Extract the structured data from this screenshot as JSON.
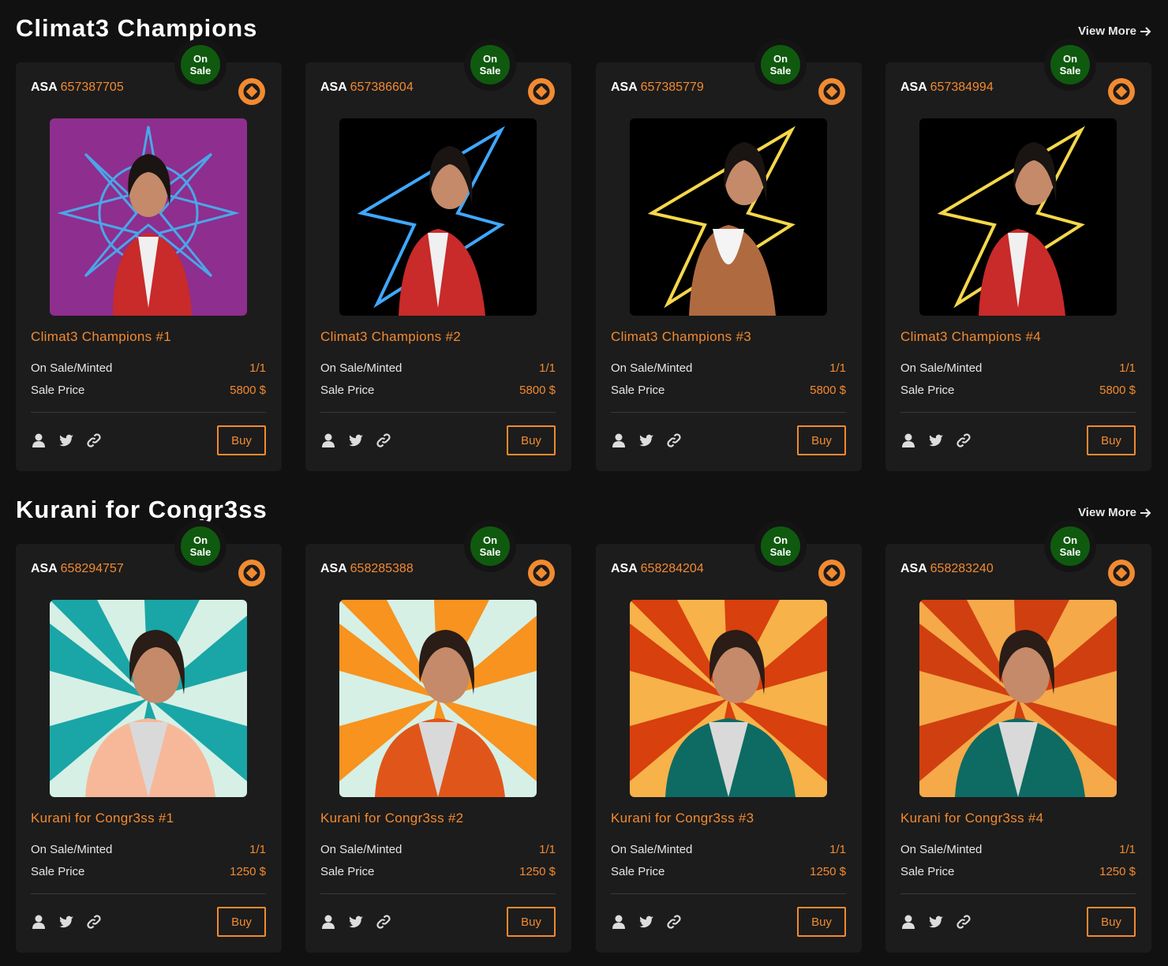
{
  "sections": [
    {
      "title": "Climat3 Champions",
      "view_more": "View More",
      "cards": [
        {
          "badge_line1": "On",
          "badge_line2": "Sale",
          "asa_label": "ASA",
          "asa_id": "657387705",
          "name": "Climat3 Champions #1",
          "on_sale_label": "On Sale/Minted",
          "on_sale_value": "1/1",
          "price_label": "Sale Price",
          "price_value": "5800 $",
          "buy_label": "Buy"
        },
        {
          "badge_line1": "On",
          "badge_line2": "Sale",
          "asa_label": "ASA",
          "asa_id": "657386604",
          "name": "Climat3 Champions #2",
          "on_sale_label": "On Sale/Minted",
          "on_sale_value": "1/1",
          "price_label": "Sale Price",
          "price_value": "5800 $",
          "buy_label": "Buy"
        },
        {
          "badge_line1": "On",
          "badge_line2": "Sale",
          "asa_label": "ASA",
          "asa_id": "657385779",
          "name": "Climat3 Champions #3",
          "on_sale_label": "On Sale/Minted",
          "on_sale_value": "1/1",
          "price_label": "Sale Price",
          "price_value": "5800 $",
          "buy_label": "Buy"
        },
        {
          "badge_line1": "On",
          "badge_line2": "Sale",
          "asa_label": "ASA",
          "asa_id": "657384994",
          "name": "Climat3 Champions #4",
          "on_sale_label": "On Sale/Minted",
          "on_sale_value": "1/1",
          "price_label": "Sale Price",
          "price_value": "5800 $",
          "buy_label": "Buy"
        }
      ]
    },
    {
      "title": "Kurani for Congr3ss",
      "view_more": "View More",
      "cards": [
        {
          "badge_line1": "On",
          "badge_line2": "Sale",
          "asa_label": "ASA",
          "asa_id": "658294757",
          "name": "Kurani for Congr3ss #1",
          "on_sale_label": "On Sale/Minted",
          "on_sale_value": "1/1",
          "price_label": "Sale Price",
          "price_value": "1250 $",
          "buy_label": "Buy"
        },
        {
          "badge_line1": "On",
          "badge_line2": "Sale",
          "asa_label": "ASA",
          "asa_id": "658285388",
          "name": "Kurani for Congr3ss #2",
          "on_sale_label": "On Sale/Minted",
          "on_sale_value": "1/1",
          "price_label": "Sale Price",
          "price_value": "1250 $",
          "buy_label": "Buy"
        },
        {
          "badge_line1": "On",
          "badge_line2": "Sale",
          "asa_label": "ASA",
          "asa_id": "658284204",
          "name": "Kurani for Congr3ss #3",
          "on_sale_label": "On Sale/Minted",
          "on_sale_value": "1/1",
          "price_label": "Sale Price",
          "price_value": "1250 $",
          "buy_label": "Buy"
        },
        {
          "badge_line1": "On",
          "badge_line2": "Sale",
          "asa_label": "ASA",
          "asa_id": "658283240",
          "name": "Kurani for Congr3ss #4",
          "on_sale_label": "On Sale/Minted",
          "on_sale_value": "1/1",
          "price_label": "Sale Price",
          "price_value": "1250 $",
          "buy_label": "Buy"
        }
      ]
    }
  ],
  "icons": {
    "brand": "orange-aperture-logo-icon",
    "profile": "user-icon",
    "twitter": "twitter-icon",
    "link": "link-icon",
    "view_more": "arrow-right-icon"
  },
  "colors": {
    "background": "#111111",
    "card": "#1c1c1c",
    "accent": "#f28a30",
    "badge": "#0f5a0f"
  }
}
